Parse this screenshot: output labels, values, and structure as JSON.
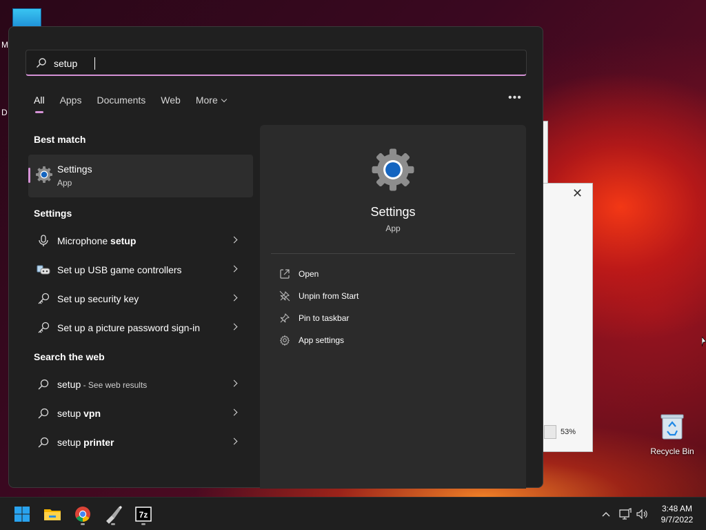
{
  "desktop": {
    "fragment_top": "M",
    "fragment_mid": "D",
    "recycle_bin_label": "Recycle Bin",
    "bg_window_progress": "53%"
  },
  "search": {
    "value": "setup"
  },
  "tabs": [
    {
      "label": "All"
    },
    {
      "label": "Apps"
    },
    {
      "label": "Documents"
    },
    {
      "label": "Web"
    },
    {
      "label": "More"
    }
  ],
  "best_match": {
    "heading": "Best match",
    "title": "Settings",
    "subtitle": "App"
  },
  "settings_section": {
    "heading": "Settings",
    "items": [
      {
        "pre": "Microphone ",
        "bold": "setup",
        "post": ""
      },
      {
        "pre": "Set up USB game controllers",
        "bold": "",
        "post": ""
      },
      {
        "pre": "Set up security key",
        "bold": "",
        "post": ""
      },
      {
        "pre": "Set up a picture password sign-in",
        "bold": "",
        "post": ""
      }
    ]
  },
  "web_section": {
    "heading": "Search the web",
    "items": [
      {
        "pre": "setup",
        "bold": "",
        "hint": " - See web results"
      },
      {
        "pre": "setup ",
        "bold": "vpn",
        "hint": ""
      },
      {
        "pre": "setup ",
        "bold": "printer",
        "hint": ""
      }
    ]
  },
  "preview": {
    "title": "Settings",
    "subtitle": "App",
    "actions": [
      {
        "label": "Open",
        "icon": "open-icon"
      },
      {
        "label": "Unpin from Start",
        "icon": "unpin-icon"
      },
      {
        "label": "Pin to taskbar",
        "icon": "pin-icon"
      },
      {
        "label": "App settings",
        "icon": "gear-icon"
      }
    ]
  },
  "taskbar": {
    "apps": [
      "start-icon",
      "file-explorer-icon",
      "chrome-icon",
      "app-icon",
      "7zip-icon"
    ],
    "seven_zip_label": "7z",
    "time": "3:48 AM",
    "date": "9/7/2022"
  },
  "colors": {
    "accent": "#d592d6",
    "menu_bg": "#202020",
    "preview_bg": "#2b2b2b"
  }
}
